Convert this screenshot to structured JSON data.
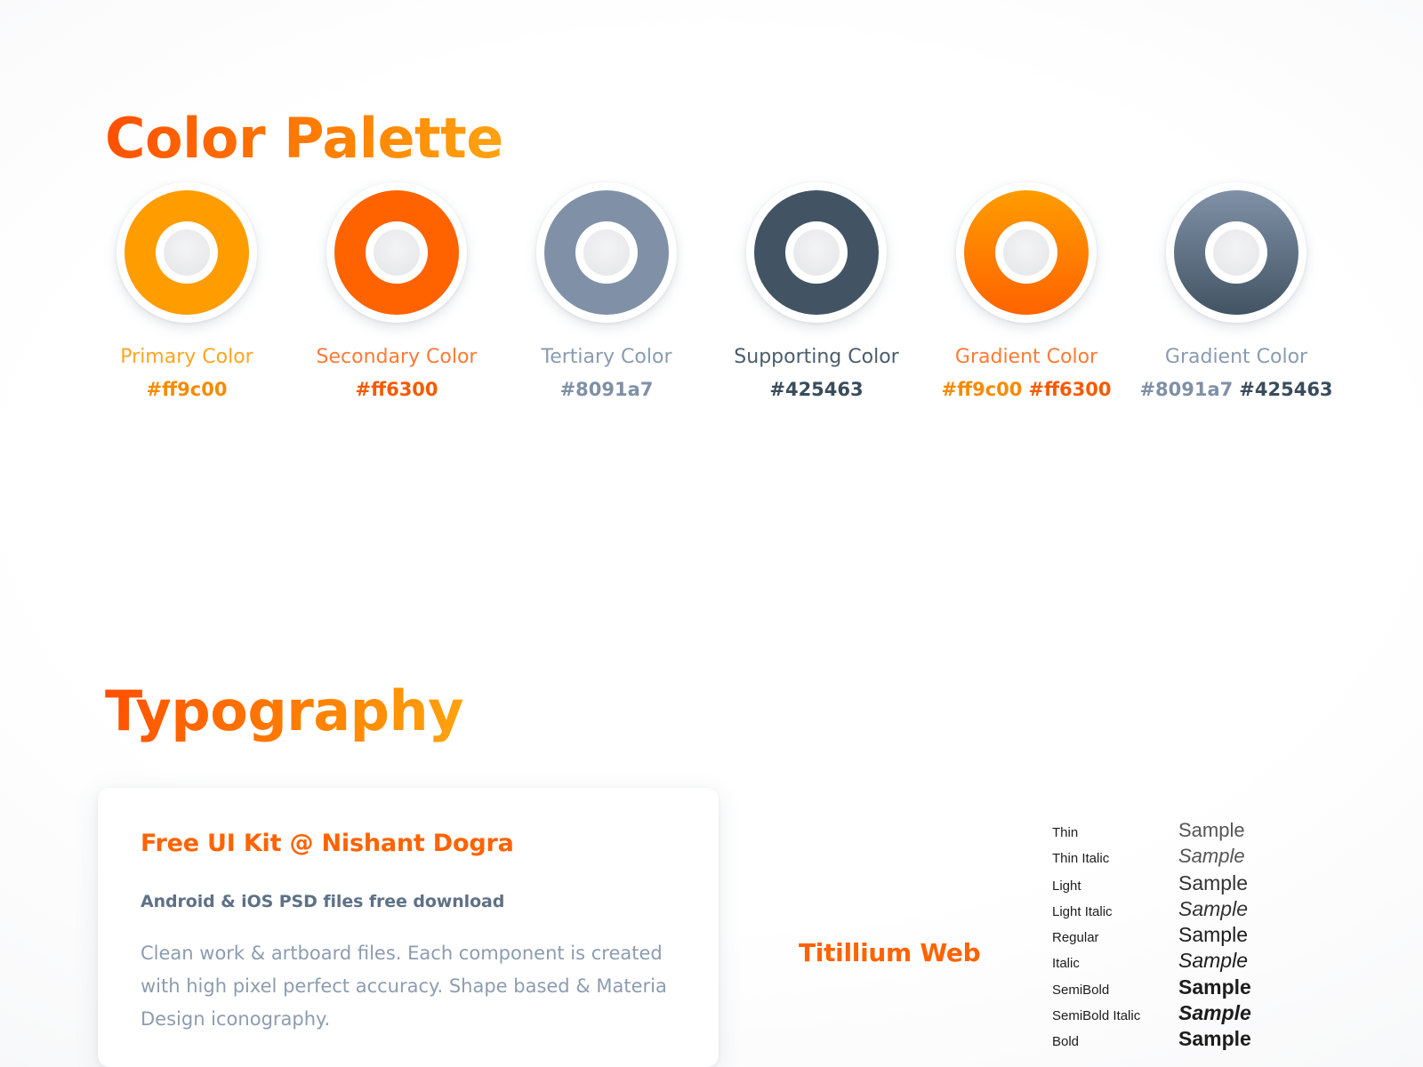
{
  "sections": {
    "palette": {
      "title": "Color Palette"
    },
    "typography": {
      "title": "Typography"
    }
  },
  "colors": {
    "primary": "#ff9c00",
    "secondary": "#ff6300",
    "tertiary": "#8091a7",
    "supporting": "#425463",
    "label_muted": "#8c9cb0",
    "heading_accent": "#ff6300"
  },
  "palette": {
    "swatches": [
      {
        "label": "Primary Color",
        "label_color": "#ffa51f",
        "hex_codes": [
          {
            "text": "#ff9c00",
            "color": "#f58b00"
          }
        ],
        "ring_style": "solid",
        "ring_color": "#ff9c00"
      },
      {
        "label": "Secondary Color",
        "label_color": "#ff7a33",
        "hex_codes": [
          {
            "text": "#ff6300",
            "color": "#f55a00"
          }
        ],
        "ring_style": "solid",
        "ring_color": "#ff6300"
      },
      {
        "label": "Tertiary Color",
        "label_color": "#8a9bb0",
        "hex_codes": [
          {
            "text": "#8091a7",
            "color": "#7f90a6"
          }
        ],
        "ring_style": "solid",
        "ring_color": "#8091a7"
      },
      {
        "label": "Supporting Color",
        "label_color": "#4a5c6b",
        "hex_codes": [
          {
            "text": "#425463",
            "color": "#3a4c5b"
          }
        ],
        "ring_style": "solid",
        "ring_color": "#425463"
      },
      {
        "label": "Gradient Color",
        "label_color": "#ff7a33",
        "hex_codes": [
          {
            "text": "#ff9c00",
            "color": "#f58b00"
          },
          {
            "text": "#ff6300",
            "color": "#f55a00"
          }
        ],
        "ring_style": "gradient",
        "ring_gradient_from": "#ff9c00",
        "ring_gradient_to": "#ff6300"
      },
      {
        "label": "Gradient Color",
        "label_color": "#8a9bb0",
        "hex_codes": [
          {
            "text": "#8091a7",
            "color": "#7f90a6"
          },
          {
            "text": "#425463",
            "color": "#3a4c5b"
          }
        ],
        "ring_style": "gradient",
        "ring_gradient_from": "#8091a7",
        "ring_gradient_to": "#425463"
      }
    ]
  },
  "card": {
    "heading": "Free UI Kit @ Nishant Dogra",
    "subheading": "Android & iOS PSD files free download",
    "body": "Clean work & artboard files. Each component is created with high pixel perfect accuracy. Shape based & Materia Design iconography."
  },
  "font_specimen": {
    "family_name": "Titillium Web",
    "sample_word": "Sample",
    "weights": [
      {
        "name": "Thin",
        "style_class": "w-thin"
      },
      {
        "name": "Thin Italic",
        "style_class": "w-thin italic"
      },
      {
        "name": "Light",
        "style_class": "w-light"
      },
      {
        "name": "Light Italic",
        "style_class": "w-light italic"
      },
      {
        "name": "Regular",
        "style_class": "w-reg"
      },
      {
        "name": "Italic",
        "style_class": "w-reg italic"
      },
      {
        "name": "SemiBold",
        "style_class": "w-semi"
      },
      {
        "name": "SemiBold Italic",
        "style_class": "w-semi italic"
      },
      {
        "name": "Bold",
        "style_class": "w-bold"
      }
    ]
  }
}
